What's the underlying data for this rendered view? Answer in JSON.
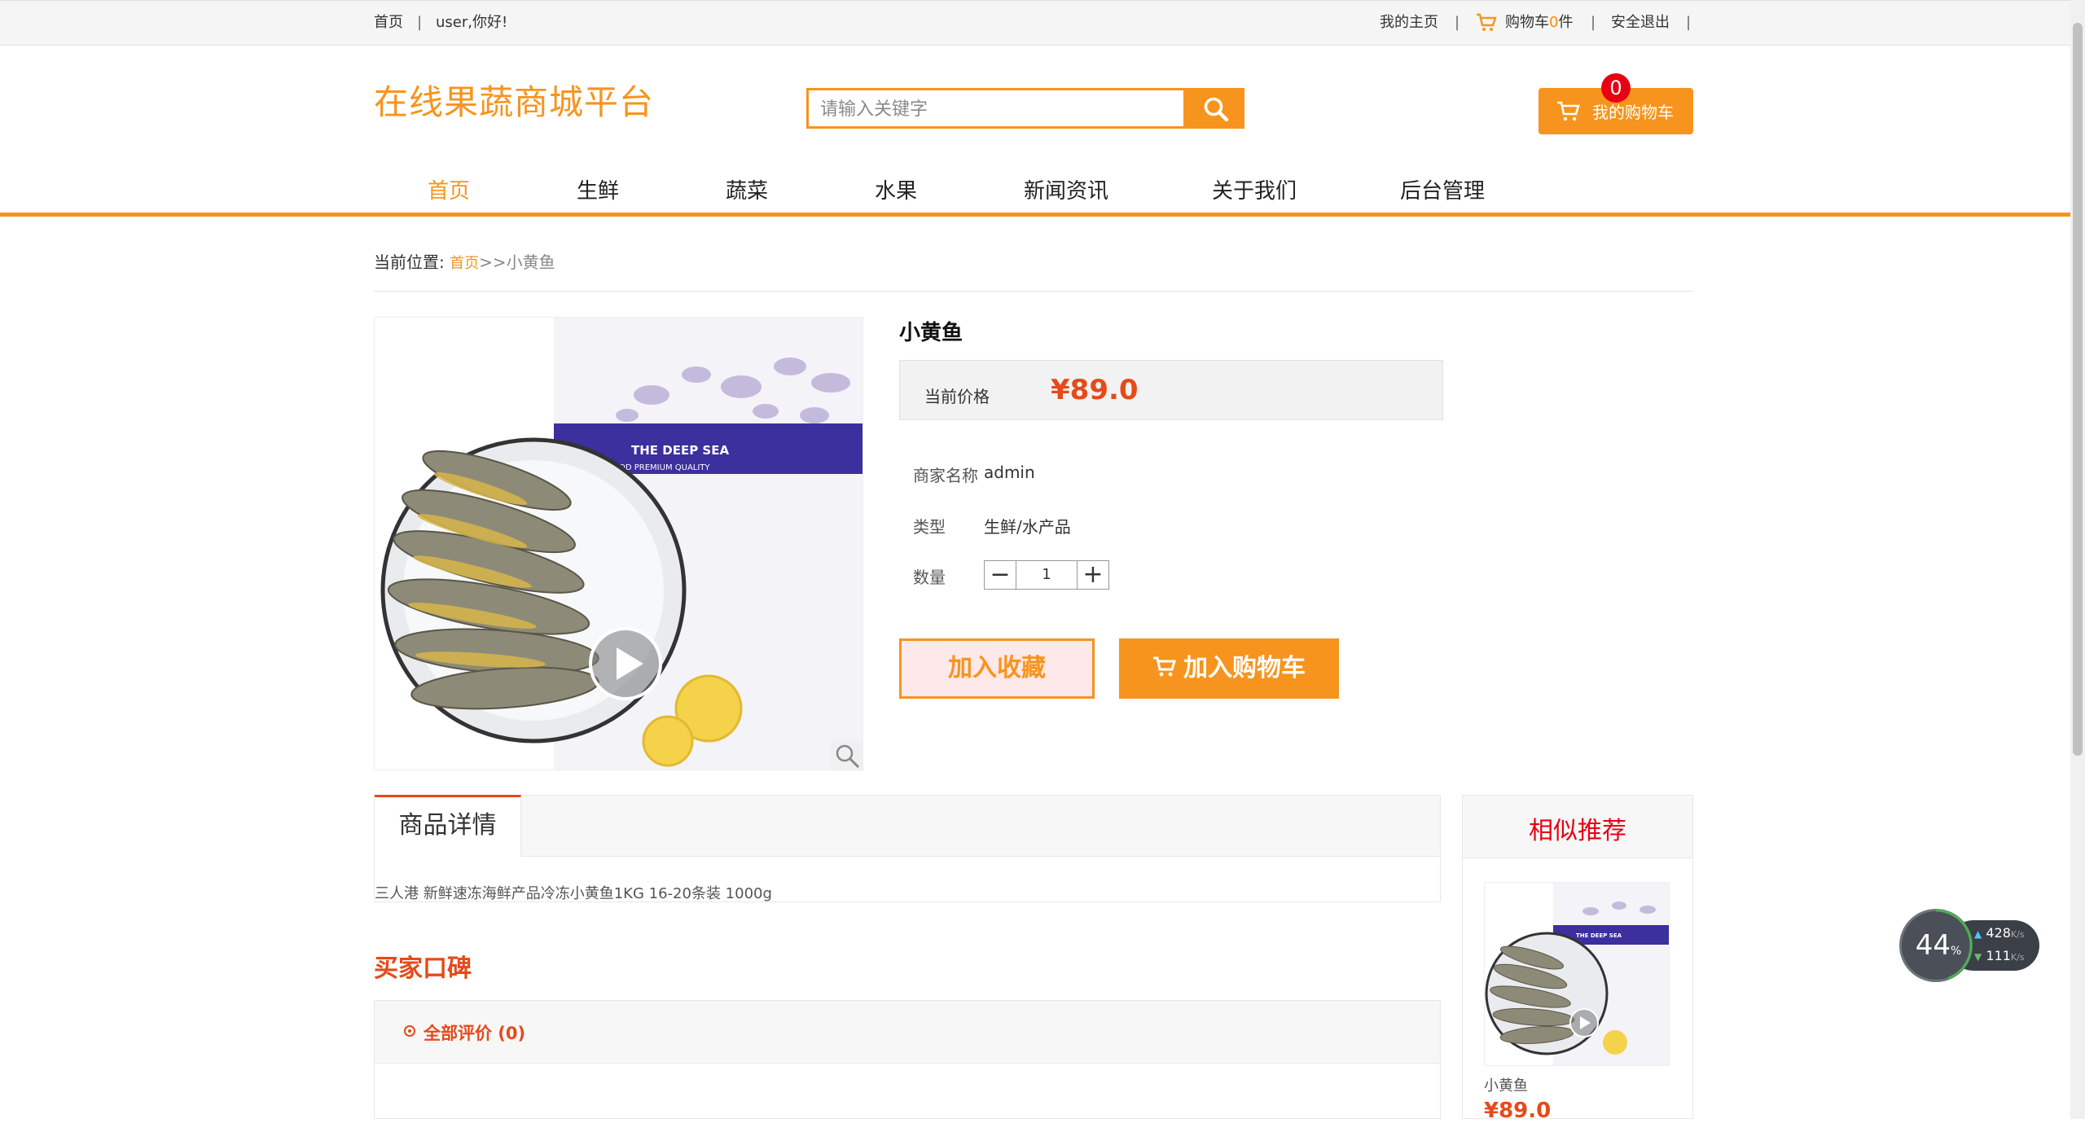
{
  "topbar": {
    "home": "首页",
    "separator": "|",
    "greeting": "user,你好!",
    "my_home": "我的主页",
    "cart_prefix": "购物车",
    "cart_count": "0",
    "cart_suffix": "件",
    "logout": "安全退出"
  },
  "header": {
    "logo": "在线果蔬商城平台",
    "search_placeholder": "请输入关键字",
    "cart_button": "我的购物车",
    "cart_badge": "0"
  },
  "nav": {
    "items": [
      "首页",
      "生鲜",
      "蔬菜",
      "水果",
      "新闻资讯",
      "关于我们",
      "后台管理"
    ],
    "active": "首页"
  },
  "breadcrumb": {
    "label": "当前位置:",
    "home": "首页",
    "sep": ">>",
    "current": "小黄鱼"
  },
  "product": {
    "name": "小黄鱼",
    "price_label": "当前价格",
    "price": "¥89.0",
    "merchant_label": "商家名称",
    "merchant": "admin",
    "type_label": "类型",
    "type": "生鲜/水产品",
    "qty_label": "数量",
    "qty_minus": "−",
    "qty": "1",
    "qty_plus": "+",
    "fav_button": "加入收藏",
    "add_cart_button": "加入购物车",
    "package_text_1": "THE DEEP SEA",
    "package_text_2": "OD PREMIUM QUALITY"
  },
  "details": {
    "tab": "商品详情",
    "text": "三人港 新鲜速冻海鲜产品冷冻小黄鱼1KG 16-20条装 1000g"
  },
  "reviews": {
    "title": "买家口碑",
    "tab": "全部评价 (0)"
  },
  "recommend": {
    "title": "相似推荐",
    "item_name": "小黄鱼",
    "item_price": "¥89.0"
  },
  "net_widget": {
    "percent": "44",
    "percent_unit": "%",
    "up": "428",
    "down": "111",
    "unit": "K/s"
  },
  "colors": {
    "accent": "#f7941d",
    "price": "#e64a19",
    "badge": "#e60012"
  }
}
